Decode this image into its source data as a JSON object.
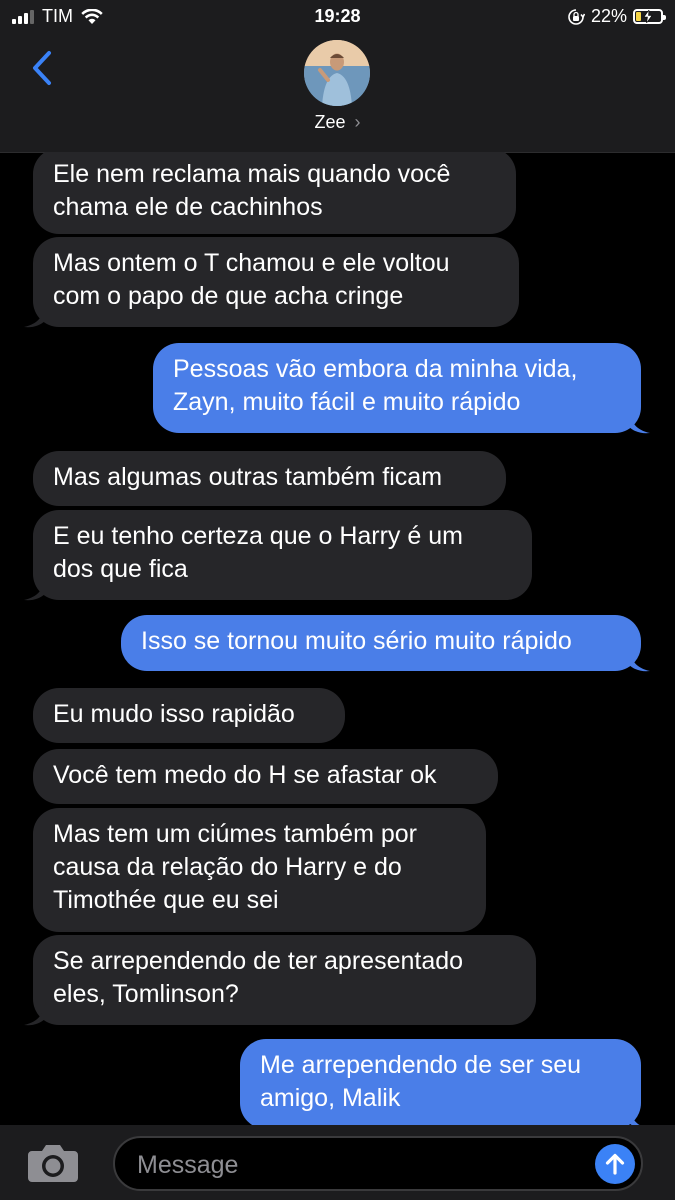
{
  "status_bar": {
    "carrier": "TIM",
    "time": "19:28",
    "battery": "22%",
    "battery_level": 0.22,
    "icons": [
      "signal-icon",
      "wifi-icon",
      "orientation-lock-icon",
      "battery-charging-icon"
    ]
  },
  "header": {
    "contact_name": "Zee",
    "chevron": "›",
    "icons": [
      "back-chevron-icon",
      "avatar"
    ]
  },
  "messages": [
    {
      "direction": "received",
      "text": "Ele nem reclama mais quando você\nchama ele de cachinhos"
    },
    {
      "direction": "received",
      "text": "Mas ontem o T chamou e ele voltou\ncom o papo de que acha cringe"
    },
    {
      "direction": "sent",
      "text": "Pessoas vão embora da minha vida,\nZayn, muito fácil e muito rápido"
    },
    {
      "direction": "received",
      "text": "Mas algumas outras também ficam"
    },
    {
      "direction": "received",
      "text": "E eu tenho certeza que o Harry é um\ndos que fica"
    },
    {
      "direction": "sent",
      "text": "Isso se tornou muito sério muito rápido"
    },
    {
      "direction": "received",
      "text": "Eu mudo isso rapidão"
    },
    {
      "direction": "received",
      "text": "Você tem medo do H se afastar ok"
    },
    {
      "direction": "received",
      "text": "Mas tem um ciúmes também por\ncausa da relação do Harry e do\nTimothée que eu sei"
    },
    {
      "direction": "received",
      "text": "Se arrependendo de ter apresentado\neles, Tomlinson?"
    },
    {
      "direction": "sent",
      "text": "Me arrependendo de ser seu\namigo, Malik"
    }
  ],
  "composer": {
    "placeholder": "Message",
    "icons": [
      "camera-icon",
      "send-arrow-icon"
    ]
  },
  "colors": {
    "background": "#000000",
    "received_bubble": "#262629",
    "sent_bubble": "#4a7ee8",
    "accent": "#3b82f6"
  }
}
